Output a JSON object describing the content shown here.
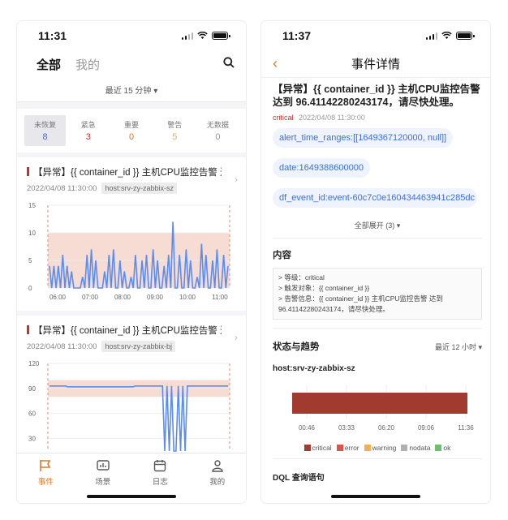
{
  "left": {
    "status_time": "11:31",
    "tabs": [
      "全部",
      "我的"
    ],
    "time_filter": "最近 15 分钟 ▾",
    "stats": [
      {
        "label": "未恢复",
        "count": "8",
        "color": "#3b6fd8"
      },
      {
        "label": "紧急",
        "count": "3",
        "color": "#c9302c"
      },
      {
        "label": "重要",
        "count": "0",
        "color": "#e0782a"
      },
      {
        "label": "警告",
        "count": "5",
        "color": "#f0b056"
      },
      {
        "label": "无数据",
        "count": "0",
        "color": "#999999"
      }
    ],
    "events": [
      {
        "title": "【异常】{{ container_id }} 主机CPU监控告警 达...",
        "time": "2022/04/08 11:30:00",
        "host": "host:srv-zy-zabbix-sz"
      },
      {
        "title": "【异常】{{ container_id }} 主机CPU监控告警 达...",
        "time": "2022/04/08 11:30:00",
        "host": "host:srv-zy-zabbix-bj"
      }
    ],
    "tabbar": [
      "事件",
      "场景",
      "日志",
      "我的"
    ]
  },
  "chart_data": [
    {
      "type": "line",
      "yticks": [
        "15",
        "10",
        "5",
        "0"
      ],
      "xticks": [
        "06:00",
        "07:00",
        "08:00",
        "09:00",
        "10:00",
        "11:00"
      ],
      "ylim": [
        0,
        15
      ],
      "threshold_band": [
        0,
        10
      ],
      "series": [
        {
          "values": [
            4,
            0,
            4,
            0,
            4,
            0,
            6,
            0,
            4,
            0,
            3,
            0,
            0,
            0,
            0,
            2,
            0,
            6,
            0,
            7,
            0,
            5,
            0,
            0,
            0,
            3,
            0,
            6,
            0,
            7,
            0,
            0,
            5,
            0,
            3,
            0,
            0,
            2,
            0,
            6,
            0,
            0,
            5,
            0,
            6,
            0,
            0,
            7,
            0,
            5,
            0,
            0,
            4,
            0,
            6,
            0,
            12,
            0,
            0,
            6,
            0,
            0,
            7,
            0,
            5,
            0,
            0,
            2,
            0,
            8,
            0,
            6,
            0,
            0,
            5,
            0,
            7,
            0,
            0,
            6,
            0,
            4
          ]
        }
      ]
    },
    {
      "type": "line",
      "yticks": [
        "120",
        "90",
        "60",
        "30"
      ],
      "ylim": [
        15,
        120
      ],
      "threshold_band": [
        80,
        100
      ],
      "series": [
        {
          "values": [
            93,
            93,
            93,
            93,
            93,
            93,
            93,
            93,
            92,
            92,
            92,
            92,
            92,
            92,
            92,
            92,
            92,
            92,
            92,
            92,
            92,
            92,
            92,
            92,
            92,
            92,
            92,
            92,
            92,
            92,
            92,
            92,
            92,
            92,
            92,
            92,
            92,
            92,
            93,
            93,
            93,
            93,
            93,
            93,
            93,
            93,
            93,
            93,
            93,
            93,
            93,
            0,
            93,
            0,
            93,
            0,
            0,
            93,
            0,
            93,
            0,
            93,
            93,
            93,
            93,
            93,
            93,
            93,
            93,
            93,
            93,
            93,
            93,
            93,
            93,
            93,
            93,
            93,
            93,
            93
          ]
        }
      ]
    },
    {
      "type": "bar",
      "xticks": [
        "00:46",
        "03:33",
        "06:20",
        "09:06",
        "11:36"
      ],
      "status": "critical",
      "legend": [
        {
          "name": "critical",
          "color": "#a23b2f"
        },
        {
          "name": "error",
          "color": "#d9534f"
        },
        {
          "name": "warning",
          "color": "#f0b056"
        },
        {
          "name": "nodata",
          "color": "#b0b0b0"
        },
        {
          "name": "ok",
          "color": "#6cbf6c"
        }
      ]
    }
  ],
  "right": {
    "status_time": "11:37",
    "header_title": "事件详情",
    "event_title": "【异常】{{ container_id }} 主机CPU监控告警 达到 96.41142280243174，请尽快处理。",
    "severity": "critical",
    "event_time": "2022/04/08 11:30:00",
    "chips": [
      "alert_time_ranges:[[1649367120000, null]]",
      "date:1649388600000",
      "df_event_id:event-60c7c0e160434463941c285dc"
    ],
    "expand_all": "全部展开 (3) ▾",
    "content_title": "内容",
    "content_lines": [
      "> 等级：critical",
      "> 触发对象：{{ container_id }}",
      "> 告警信息：{{ container_id }} 主机CPU监控告警 达到",
      "96.41142280243174，请尽快处理。"
    ],
    "trend_title": "状态与趋势",
    "trend_range": "最近 12 小时 ▾",
    "host": "host:srv-zy-zabbix-sz",
    "dql_title": "DQL 查询语句"
  }
}
